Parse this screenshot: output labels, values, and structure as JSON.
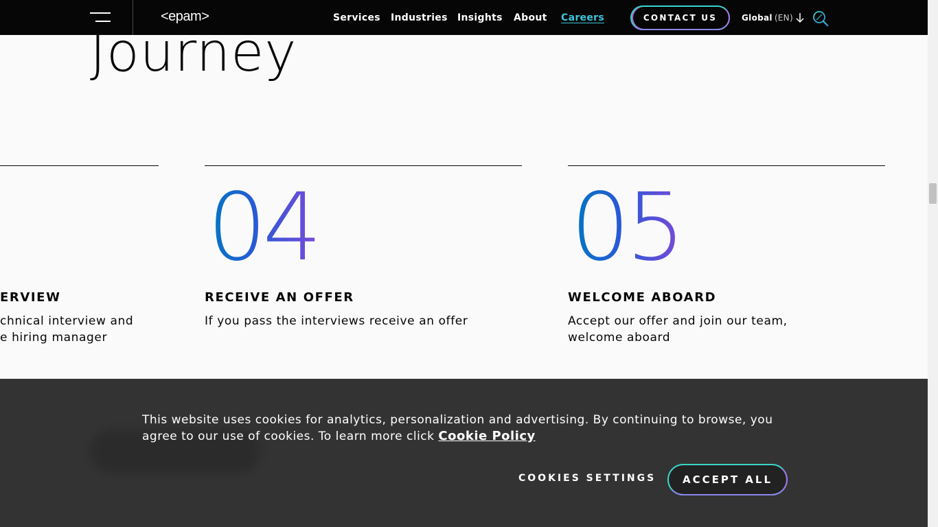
{
  "header": {
    "logo": "<epam>",
    "nav": [
      {
        "label": "Services"
      },
      {
        "label": "Industries"
      },
      {
        "label": "Insights"
      },
      {
        "label": "About"
      },
      {
        "label": "Careers",
        "active": true
      }
    ],
    "contact_label": "CONTACT US",
    "lang_label": "Global",
    "lang_code": "(EN)"
  },
  "section": {
    "heading": "Journey"
  },
  "steps": [
    {
      "number": "",
      "title": "ERVIEW",
      "desc": "chnical interview and\ne hiring manager"
    },
    {
      "number": "04",
      "title": "RECEIVE AN OFFER",
      "desc": "If you pass the interviews receive an offer"
    },
    {
      "number": "05",
      "title": "WELCOME ABOARD",
      "desc": "Accept our offer and join our team,\nwelcome aboard"
    }
  ],
  "cookie": {
    "text": "This website uses cookies for analytics, personalization and advertising. By continuing to browse, you agree to our use of cookies. To learn more click ",
    "link_label": "Cookie Policy",
    "settings_label": "COOKIES SETTINGS",
    "accept_label": "ACCEPT ALL"
  },
  "colors": {
    "header_bg": "#060606",
    "accent_teal": "#3dc5db",
    "accent_purple": "#a074e6",
    "cookie_bg": "#333333"
  }
}
